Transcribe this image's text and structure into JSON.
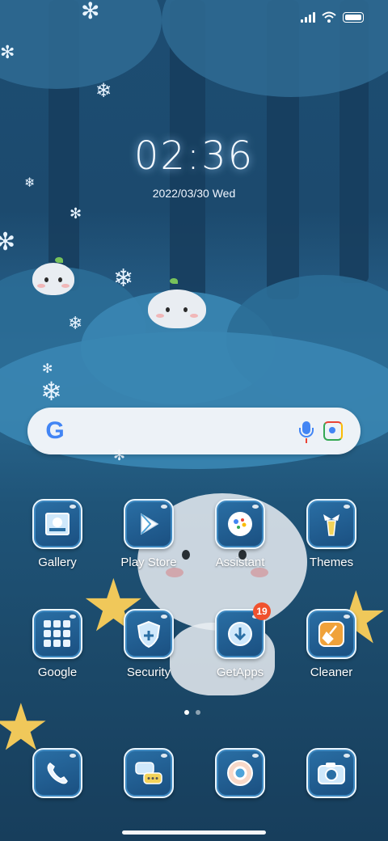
{
  "status_bar": {
    "icons": [
      "signal-icon",
      "wifi-icon",
      "battery-icon"
    ]
  },
  "lock": {
    "time": "02:36",
    "date": "2022/03/30  Wed"
  },
  "search": {
    "logo": "G",
    "icons": [
      "google-logo-icon",
      "mic-icon",
      "lens-icon"
    ]
  },
  "apps": [
    {
      "label": "Gallery",
      "icon": "gallery-icon"
    },
    {
      "label": "Play Store",
      "icon": "play-store-icon"
    },
    {
      "label": "Assistant",
      "icon": "assistant-icon"
    },
    {
      "label": "Themes",
      "icon": "themes-icon"
    },
    {
      "label": "Google",
      "icon": "google-folder-icon"
    },
    {
      "label": "Security",
      "icon": "security-icon"
    },
    {
      "label": "GetApps",
      "icon": "getapps-icon",
      "badge": "19"
    },
    {
      "label": "Cleaner",
      "icon": "cleaner-icon"
    }
  ],
  "dock": [
    {
      "icon": "phone-icon"
    },
    {
      "icon": "messages-icon"
    },
    {
      "icon": "chrome-icon"
    },
    {
      "icon": "camera-icon"
    }
  ],
  "page_indicator": {
    "pages": 2,
    "current": 1
  },
  "colors": {
    "accent": "#f0522e",
    "icon_bg": "#1a4f80",
    "wallpaper": "#1c4a6e"
  }
}
